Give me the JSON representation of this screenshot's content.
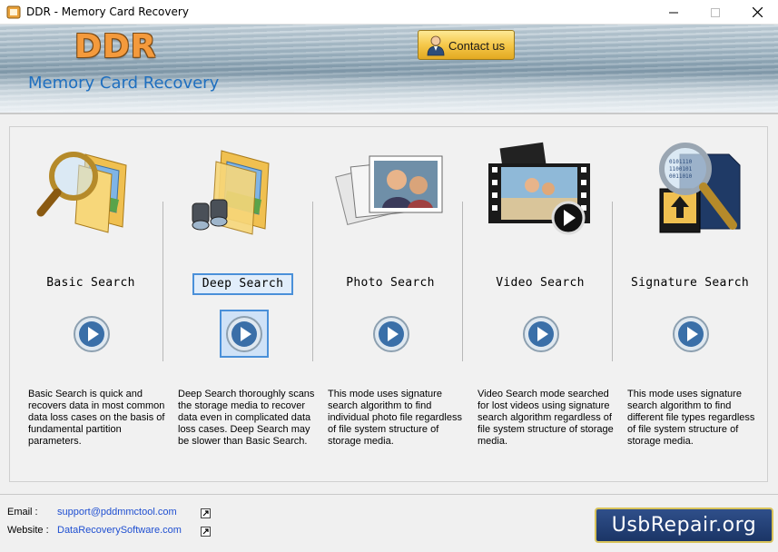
{
  "window": {
    "title": "DDR - Memory Card Recovery"
  },
  "header": {
    "logo": "DDR",
    "product_name": "Memory Card Recovery",
    "contact_label": "Contact us"
  },
  "modes": [
    {
      "title": "Basic Search",
      "description": "Basic Search is quick and recovers data in most common data loss cases on the basis of fundamental partition parameters."
    },
    {
      "title": "Deep Search",
      "description": "Deep Search thoroughly scans the storage media to recover data even in complicated data loss cases. Deep Search may be slower than Basic Search."
    },
    {
      "title": "Photo Search",
      "description": "This mode uses signature search algorithm to find individual photo file regardless of file system structure of storage media."
    },
    {
      "title": "Video Search",
      "description": "Video Search mode searched for lost videos using signature search algorithm regardless of file system structure of storage media."
    },
    {
      "title": "Signature Search",
      "description": "This mode uses signature search algorithm to find different file types regardless of file system structure of storage media."
    }
  ],
  "footer": {
    "email_label": "Email :",
    "email_value": "support@pddmmctool.com",
    "website_label": "Website :",
    "website_value": "DataRecoverySoftware.com",
    "brand": "UsbRepair.org"
  },
  "colors": {
    "accent_blue": "#4a90d9",
    "link": "#1f4fd1",
    "logo_orange": "#f49a3c"
  }
}
